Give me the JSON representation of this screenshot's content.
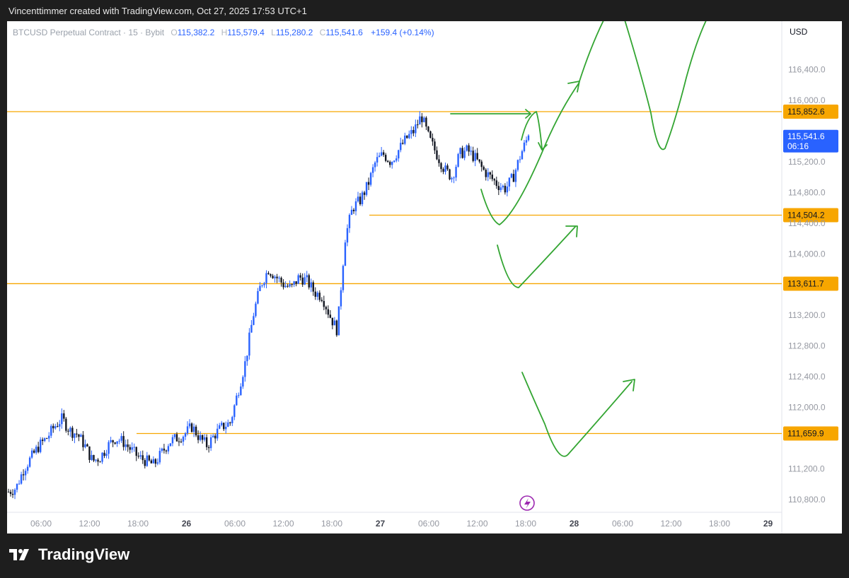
{
  "header": {
    "credit": "Vincenttimmer created with TradingView.com, Oct 27, 2025 17:53 UTC+1"
  },
  "legend": {
    "symbol": "BTCUSD Perpetual Contract · 15 · Bybit",
    "o_label": "O",
    "o": "115,382.2",
    "h_label": "H",
    "h": "115,579.4",
    "l_label": "L",
    "l": "115,280.2",
    "c_label": "C",
    "c": "115,541.6",
    "change": "+159.4 (+0.14%)"
  },
  "currency": "USD",
  "brand": {
    "name": "TradingView",
    "logo_icon": "tradingview-logo-icon"
  },
  "colors": {
    "up": "#2962ff",
    "down": "#131722",
    "level": "#f7a600",
    "drawing": "#33a532",
    "price_tag": "#2962ff",
    "flash": "#9c27b0"
  },
  "chart_data": {
    "type": "candlestick",
    "title": "BTCUSD Perpetual Contract · 15 · Bybit",
    "y_ticks": [
      "116,400.0",
      "116,000.0",
      "115,200.0",
      "114,800.0",
      "114,400.0",
      "114,000.0",
      "113,200.0",
      "112,800.0",
      "112,400.0",
      "112,000.0",
      "111,200.0",
      "110,800.0"
    ],
    "x_ticks": [
      "06:00",
      "12:00",
      "18:00",
      "26",
      "06:00",
      "12:00",
      "18:00",
      "27",
      "06:00",
      "12:00",
      "18:00",
      "28",
      "06:00",
      "12:00",
      "18:00",
      "29"
    ],
    "ylim": [
      110650,
      116800
    ],
    "levels": [
      {
        "label": "115,852.6",
        "value": 115852.6
      },
      {
        "label": "114,504.2",
        "value": 114504.2
      },
      {
        "label": "113,611.7",
        "value": 113611.7
      },
      {
        "label": "111,659.9",
        "value": 111659.9
      }
    ],
    "current_price": {
      "label": "115,541.6",
      "countdown": "06:16",
      "value": 115541.6
    },
    "price_path": [
      110900,
      110950,
      111200,
      111350,
      111500,
      111600,
      111750,
      111850,
      111700,
      111650,
      111500,
      111300,
      111350,
      111500,
      111600,
      111550,
      111450,
      111350,
      111300,
      111250,
      111400,
      111550,
      111600,
      111650,
      111750,
      111600,
      111500,
      111650,
      111750,
      111800,
      112200,
      112600,
      113200,
      113600,
      113800,
      113700,
      113600,
      113550,
      113700,
      113650,
      113500,
      113450,
      113200,
      113000,
      114200,
      114600,
      114700,
      114900,
      115200,
      115300,
      115200,
      115350,
      115500,
      115600,
      115800,
      115500,
      115300,
      115100,
      115000,
      115300,
      115350,
      115250,
      115100,
      115000,
      114900,
      114850,
      115000,
      115300,
      115541.6
    ]
  }
}
